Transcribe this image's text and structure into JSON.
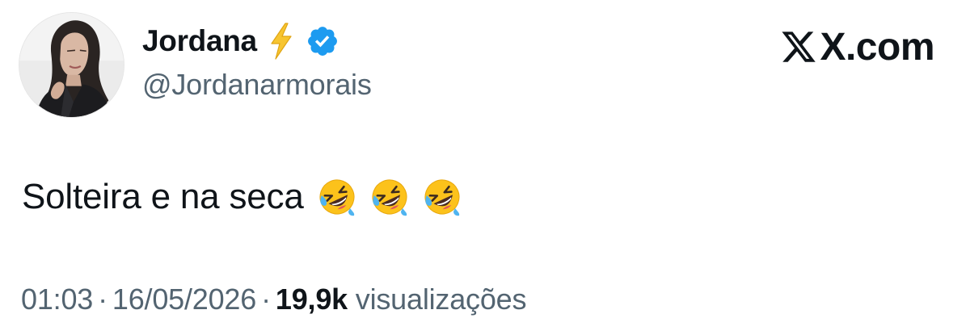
{
  "author": {
    "display_name": "Jordana",
    "name_emoji": "lightning-bolt-icon",
    "verified": true,
    "handle": "@Jordanarmorais",
    "avatar": "profile-photo"
  },
  "brand": {
    "logo": "x-logo-icon",
    "text": "X.com"
  },
  "tweet": {
    "text": "Solteira e na seca",
    "emojis": [
      "rolling-on-floor-laughing-icon",
      "rolling-on-floor-laughing-icon",
      "rolling-on-floor-laughing-icon"
    ]
  },
  "meta": {
    "time": "01:03",
    "separator": "·",
    "date": "16/05/2026",
    "views_count": "19,9k",
    "views_label": "visualizações"
  },
  "colors": {
    "text_primary": "#0f1419",
    "text_secondary": "#536471",
    "verified_blue": "#1d9bf0",
    "bolt_yellow": "#f7c531",
    "emoji_yellow": "#fcc21b"
  }
}
